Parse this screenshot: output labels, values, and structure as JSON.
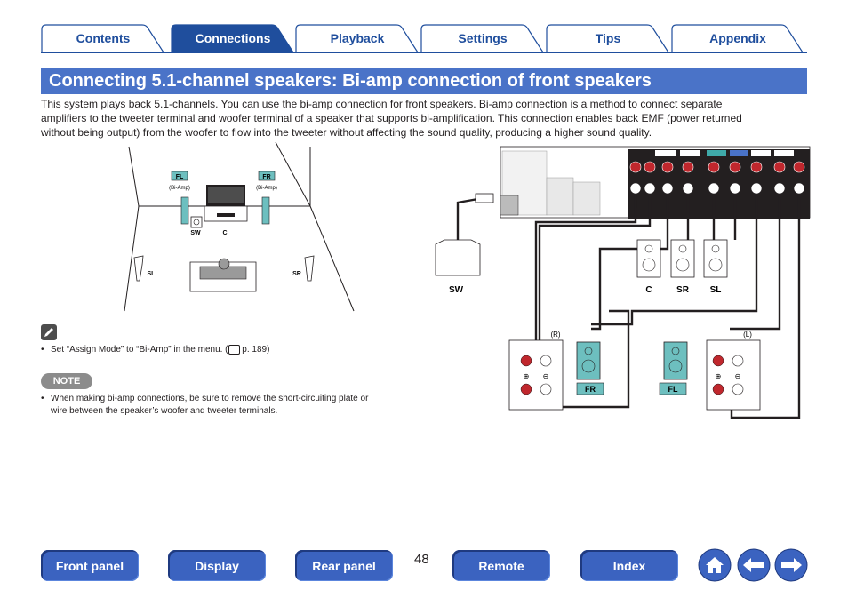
{
  "tabs": [
    {
      "label": "Contents",
      "active": false
    },
    {
      "label": "Connections",
      "active": true
    },
    {
      "label": "Playback",
      "active": false
    },
    {
      "label": "Settings",
      "active": false
    },
    {
      "label": "Tips",
      "active": false
    },
    {
      "label": "Appendix",
      "active": false
    }
  ],
  "page_title": "Connecting 5.1-channel speakers: Bi-amp connection of front speakers",
  "intro": [
    "This system plays back 5.1-channels. You can use the bi-amp connection for front speakers. Bi-amp connection is a method to connect separate",
    "amplifiers to the tweeter terminal and woofer terminal of a speaker that supports bi-amplification. This connection enables back EMF (power returned",
    "without being output) from the woofer to flow into the tweeter without affecting the sound quality, producing a higher sound quality."
  ],
  "room": {
    "fl": "FL",
    "fr": "FR",
    "fl_sub": "(Bi-Amp)",
    "fr_sub": "(Bi-Amp)",
    "sw": "SW",
    "c": "C",
    "sl": "SL",
    "sr": "SR"
  },
  "diagram": {
    "sw": "SW",
    "c": "C",
    "sr": "SR",
    "sl": "SL",
    "r": "(R)",
    "l": "(L)",
    "fr": "FR",
    "fl": "FL",
    "plus": "⊕",
    "minus": "⊖"
  },
  "tip": {
    "text": "Set “Assign Mode” to “Bi-Amp” in the menu.  (",
    "page_ref": " p. 189)"
  },
  "note": {
    "badge": "NOTE",
    "text1": "When making bi-amp connections, be sure to remove the short-circuiting plate or",
    "text2": "wire between the speaker’s woofer and tweeter terminals."
  },
  "page_number": "48",
  "bottom_nav": [
    {
      "label": "Front panel"
    },
    {
      "label": "Display"
    },
    {
      "label": "Rear panel"
    },
    {
      "label": "Remote"
    },
    {
      "label": "Index"
    }
  ],
  "colors": {
    "accent": "#4a73c8",
    "tab_blue": "#1f4e9d",
    "button_blue": "#3b63c0",
    "terminal_red": "#c0272d"
  }
}
